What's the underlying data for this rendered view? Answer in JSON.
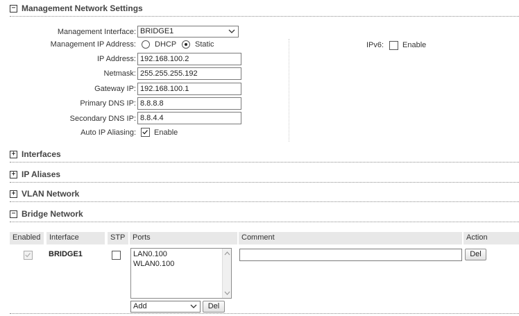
{
  "sections": {
    "management": {
      "toggle": "−",
      "title": "Management Network Settings"
    },
    "interfaces": {
      "toggle": "+",
      "title": "Interfaces"
    },
    "ip_aliases": {
      "toggle": "+",
      "title": "IP Aliases"
    },
    "vlan": {
      "toggle": "+",
      "title": "VLAN Network"
    },
    "bridge": {
      "toggle": "−",
      "title": "Bridge Network"
    }
  },
  "management": {
    "interface_label": "Management Interface:",
    "interface_value": "BRIDGE1",
    "ip_mode_label": "Management IP Address:",
    "dhcp_label": "DHCP",
    "static_label": "Static",
    "ip_label": "IP Address:",
    "ip_value": "192.168.100.2",
    "netmask_label": "Netmask:",
    "netmask_value": "255.255.255.192",
    "gateway_label": "Gateway IP:",
    "gateway_value": "192.168.100.1",
    "primary_dns_label": "Primary DNS IP:",
    "primary_dns_value": "8.8.8.8",
    "secondary_dns_label": "Secondary DNS IP:",
    "secondary_dns_value": "8.8.4.4",
    "auto_alias_label": "Auto IP Aliasing:",
    "auto_alias_enable": "Enable",
    "ipv6_label": "IPv6:",
    "ipv6_enable": "Enable"
  },
  "bridge_table": {
    "headers": [
      "Enabled",
      "Interface",
      "STP",
      "Ports",
      "Comment",
      "Action"
    ],
    "row": {
      "interface": "BRIDGE1",
      "ports": [
        "LAN0.100",
        "WLAN0.100"
      ],
      "comment": "",
      "action_label": "Del",
      "add_select": "Add",
      "port_del_label": "Del"
    }
  }
}
